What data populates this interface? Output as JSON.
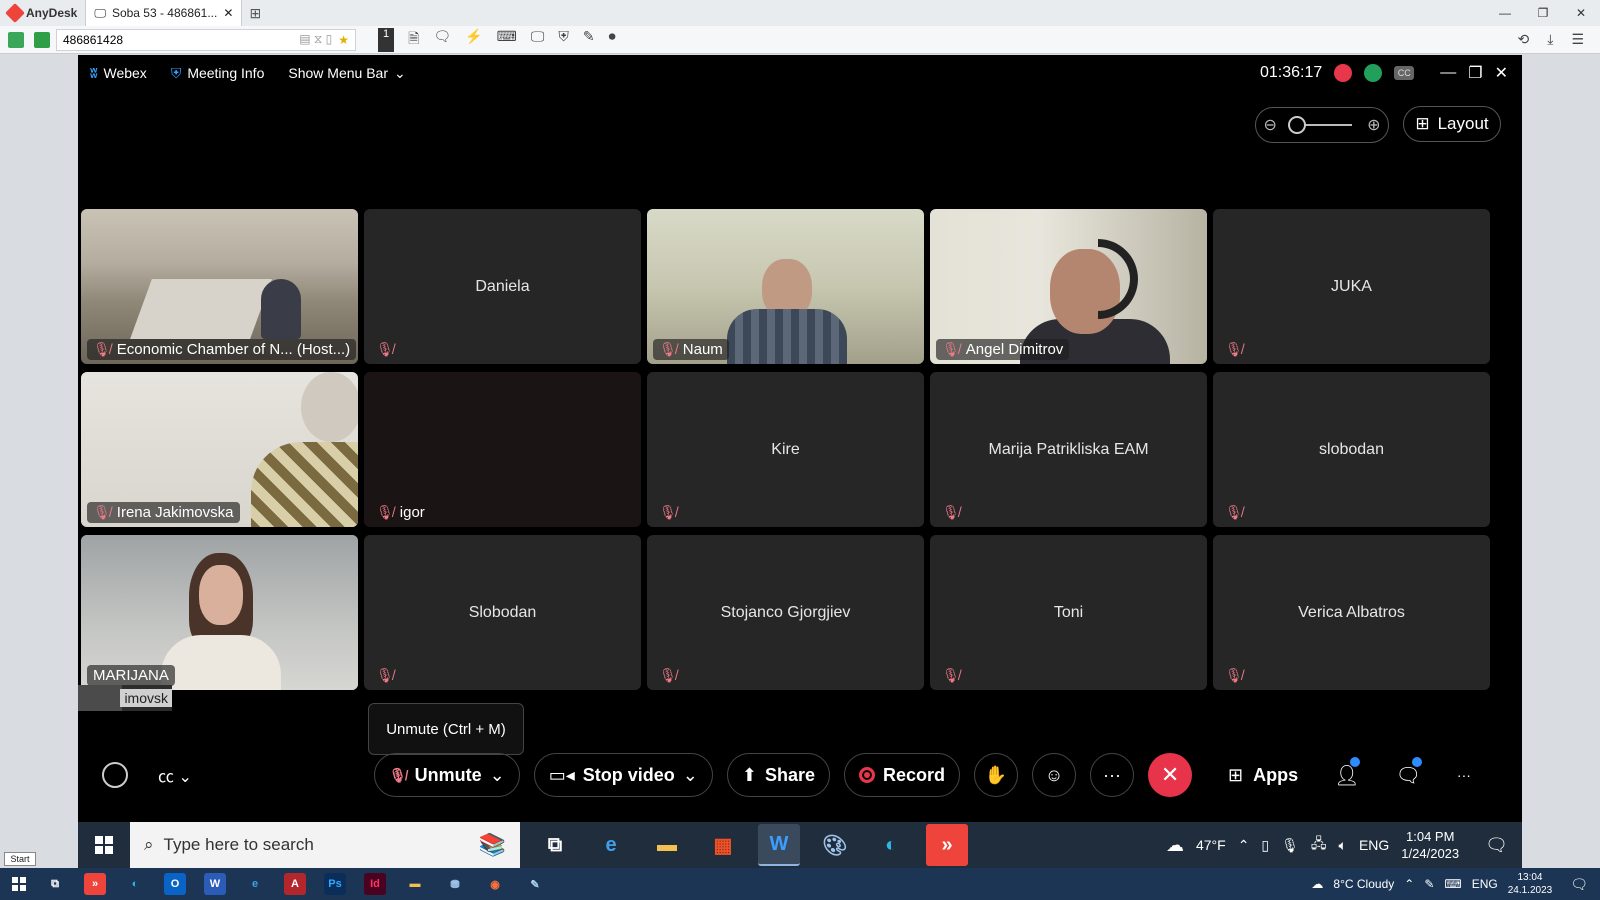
{
  "anydesk": {
    "app_name": "AnyDesk",
    "tab_title": "Soba 53 - 486861...",
    "address": "486861428",
    "monitor_number": "1"
  },
  "webex": {
    "brand": "Webex",
    "meeting_info": "Meeting Info",
    "show_menu_bar": "Show Menu Bar",
    "timer": "01:36:17",
    "cc_label": "CC",
    "layout_label": "Layout"
  },
  "participants": [
    {
      "name": "Economic Chamber of N... (Host...)",
      "video": true,
      "muted": true
    },
    {
      "name": "Daniela",
      "video": false,
      "muted": true
    },
    {
      "name": "Naum",
      "video": true,
      "muted": true
    },
    {
      "name": "Angel Dimitrov",
      "video": true,
      "muted": true
    },
    {
      "name": "JUKA",
      "video": false,
      "muted": true
    },
    {
      "name": "Irena Jakimovska",
      "video": true,
      "muted": true
    },
    {
      "name": "igor",
      "video": false,
      "muted": true
    },
    {
      "name": "Kire",
      "video": false,
      "muted": true
    },
    {
      "name": "Marija Patrikliska EAM",
      "video": false,
      "muted": true
    },
    {
      "name": "slobodan",
      "video": false,
      "muted": true
    },
    {
      "name": "MARIJANA",
      "video": true,
      "muted": false
    },
    {
      "name": "Slobodan",
      "video": false,
      "muted": true
    },
    {
      "name": "Stojanco Gjorgjiev",
      "video": false,
      "muted": true
    },
    {
      "name": "Toni",
      "video": false,
      "muted": true
    },
    {
      "name": "Verica Albatros",
      "video": false,
      "muted": true
    }
  ],
  "self_strip": "imovsk",
  "tooltip": "Unmute (Ctrl + M)",
  "controls": {
    "unmute": "Unmute",
    "stop_video": "Stop video",
    "share": "Share",
    "record": "Record",
    "apps": "Apps",
    "more": "···"
  },
  "remote_taskbar": {
    "search_placeholder": "Type here to search",
    "weather": "47°F",
    "lang": "ENG",
    "time": "1:04 PM",
    "date": "1/24/2023"
  },
  "local_taskbar": {
    "start_tip": "Start",
    "weather": "8°C  Cloudy",
    "lang": "ENG",
    "time": "13:04",
    "date": "24.1.2023"
  }
}
